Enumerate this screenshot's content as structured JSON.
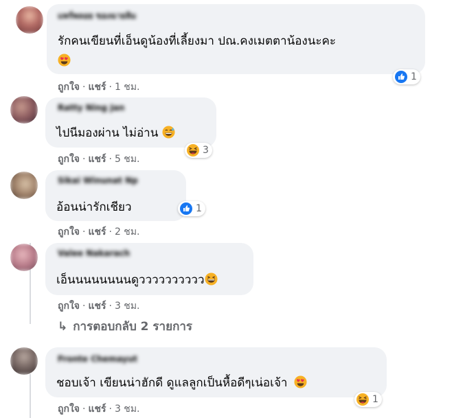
{
  "comments": [
    {
      "author": "แพร์พลอย ของฉายลิม",
      "text": "รักคนเขียนที่เอ็นดูน้องที่เลี้ยงมา ปณ.คงเมตตาน้องนะคะ",
      "text_emoji": "heart-eyes-emoji",
      "reaction": {
        "icon": "like-icon",
        "count": "1"
      },
      "actions": {
        "like": "ถูกใจ",
        "share": "แชร์",
        "time": "1 ชม."
      }
    },
    {
      "author": "Ratty Ning Jan",
      "text": "ไปนีมองผ่าน ไม่อ่าน",
      "text_emoji": "grin-sweat-emoji",
      "reaction": {
        "icon": "haha-icon",
        "count": "3"
      },
      "actions": {
        "like": "ถูกใจ",
        "share": "แชร์",
        "time": "5 ชม."
      }
    },
    {
      "author": "Sikai Winunat Np",
      "text": "อ้อนน่ารักเชียว",
      "reaction": {
        "icon": "like-icon",
        "count": "1"
      },
      "actions": {
        "like": "ถูกใจ",
        "share": "แชร์",
        "time": "2 ชม."
      }
    },
    {
      "author": "Valee Nakarach",
      "text": "เอ็นนนนนนนนดูวววววววววว",
      "text_emoji": "laughing-emoji",
      "actions": {
        "like": "ถูกใจ",
        "share": "แชร์",
        "time": "3 ชม."
      }
    },
    {
      "author": "Fronte Chemayut",
      "text": "ชอบเจ้า เขียนน่าฮักดี ดูแลลูกเป็นหื้อดีๆเน่อเจ้า",
      "text_emoji": "heart-eyes-emoji",
      "reaction": {
        "icon": "haha-icon",
        "count": "1"
      },
      "actions": {
        "like": "ถูกใจ",
        "share": "แชร์",
        "time": "3 ชม."
      }
    }
  ],
  "replies_link": "การตอบกลับ 2 รายการ",
  "colors": {
    "bubble": "#f0f2f5",
    "like_blue": "#1877f2",
    "haha_yellow": "#f7b125",
    "muted": "#65676b"
  }
}
